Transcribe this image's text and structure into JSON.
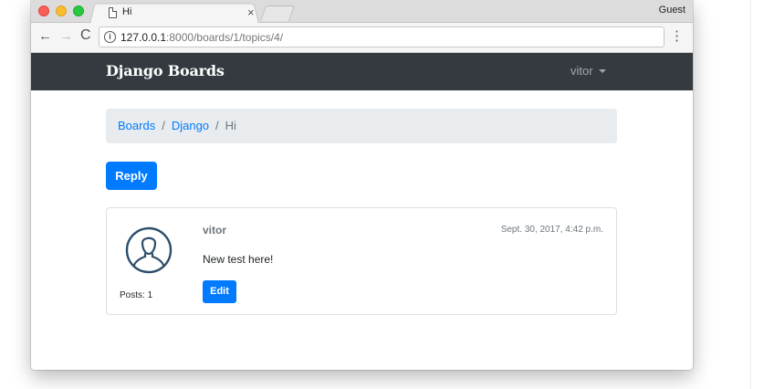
{
  "browser": {
    "tab_title": "Hi",
    "tab_close": "×",
    "profile_label": "Guest",
    "url_host": "127.0.0.1",
    "url_rest": ":8000/boards/1/topics/4/",
    "info_glyph": "i",
    "back_glyph": "←",
    "forward_glyph": "→",
    "reload_glyph": "C",
    "menu_glyph": "⋮"
  },
  "navbar": {
    "brand": "Django Boards",
    "user": "vitor",
    "background": "#343a40"
  },
  "breadcrumb": {
    "items": [
      "Boards",
      "Django"
    ],
    "separator": "/",
    "active": "Hi"
  },
  "actions": {
    "reply_label": "Reply"
  },
  "post": {
    "author": "vitor",
    "date": "Sept. 30, 2017, 4:42 p.m.",
    "message": "New test here!",
    "posts_count": "Posts: 1",
    "edit_label": "Edit",
    "avatar_icon": "user-silhouette-icon"
  },
  "colors": {
    "primary": "#007bff",
    "breadcrumb_bg": "#e9ecef",
    "muted": "#6c757d"
  }
}
